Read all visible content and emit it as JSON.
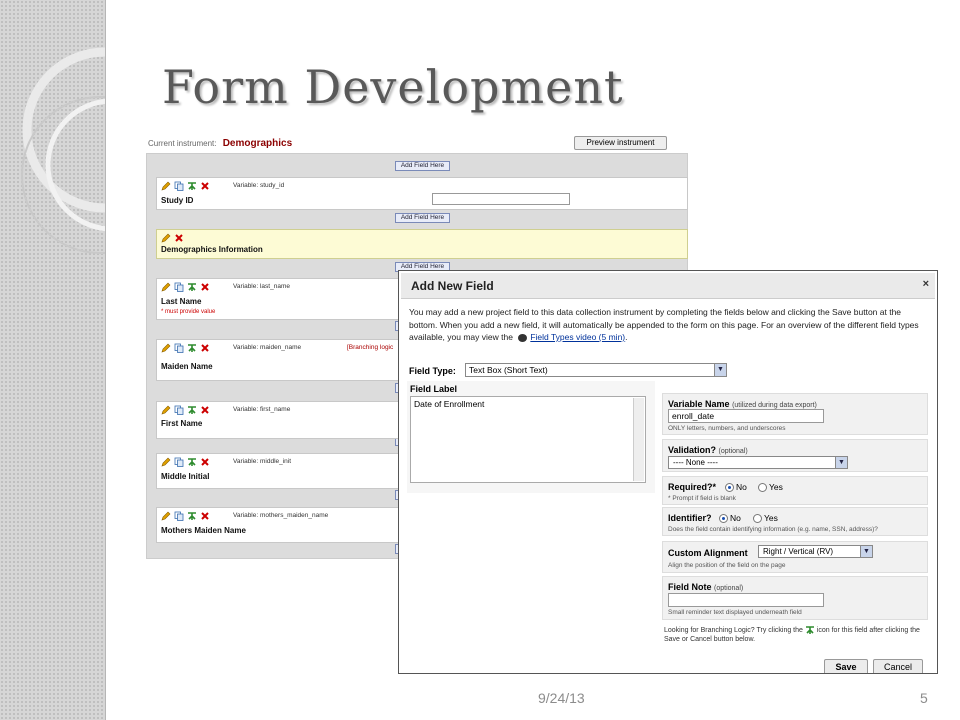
{
  "slide": {
    "title": "Form Development",
    "date": "9/24/13",
    "page_number": "5"
  },
  "builder": {
    "current_instrument_label": "Current instrument:",
    "current_instrument_name": "Demographics",
    "preview_button": "Preview instrument",
    "add_field_here": "Add Field Here",
    "fields": [
      {
        "variable": "Variable: study_id",
        "label": "Study ID",
        "note": "",
        "branching": ""
      },
      {
        "variable": "",
        "label": "Demographics Information",
        "note": "",
        "branching": ""
      },
      {
        "variable": "Variable: last_name",
        "label": "Last Name",
        "note": "* must provide value",
        "branching": ""
      },
      {
        "variable": "Variable: maiden_name",
        "label": "Maiden Name",
        "note": "",
        "branching": "[Branching logic"
      },
      {
        "variable": "Variable: first_name",
        "label": "First Name",
        "note": "",
        "branching": ""
      },
      {
        "variable": "Variable: middle_init",
        "label": "Middle Initial",
        "note": "",
        "branching": ""
      },
      {
        "variable": "Variable: mothers_maiden_name",
        "label": "Mothers Maiden Name",
        "note": "",
        "branching": ""
      }
    ]
  },
  "dialog": {
    "title": "Add New Field",
    "close_glyph": "×",
    "intro_text": "You may add a new project field to this data collection instrument by completing the fields below and clicking the Save button at the bottom. When you add a new field, it will automatically be appended to the form on this page. For an overview of the different field types available, you may view the",
    "intro_link": "Field Types video (5 min)",
    "intro_end": ".",
    "field_type_label": "Field Type:",
    "field_type_value": "Text Box (Short Text)",
    "field_label_heading": "Field Label",
    "field_label_value": "Date of Enrollment",
    "variable_name": {
      "title": "Variable Name",
      "hint_inline": "(utilized during data export)",
      "value": "enroll_date",
      "hint": "ONLY letters, numbers, and underscores"
    },
    "validation": {
      "title": "Validation?",
      "optional": "(optional)",
      "value": "---- None ----"
    },
    "required": {
      "title": "Required?*",
      "no": "No",
      "yes": "Yes",
      "selected": "No",
      "hint": "* Prompt if field is blank"
    },
    "identifier": {
      "title": "Identifier?",
      "no": "No",
      "yes": "Yes",
      "selected": "No",
      "hint": "Does the field contain identifying information (e.g. name, SSN, address)?"
    },
    "custom_alignment": {
      "title": "Custom Alignment",
      "value": "Right / Vertical (RV)",
      "hint": "Align the position of the field on the page"
    },
    "field_note": {
      "title": "Field Note",
      "optional": "(optional)",
      "value": "",
      "hint": "Small reminder text displayed underneath field"
    },
    "branching_note_a": "Looking for Branching Logic? Try clicking the",
    "branching_note_b": "icon for this field after clicking the Save or Cancel button below.",
    "save_button": "Save",
    "cancel_button": "Cancel"
  },
  "colors": {
    "instrument_name": "#8b0000",
    "pencil_icon": "#e0a000",
    "delete_icon": "#cc0000",
    "branch_icon": "#2e8b2e",
    "header_field_bg": "#fdfbd5"
  }
}
